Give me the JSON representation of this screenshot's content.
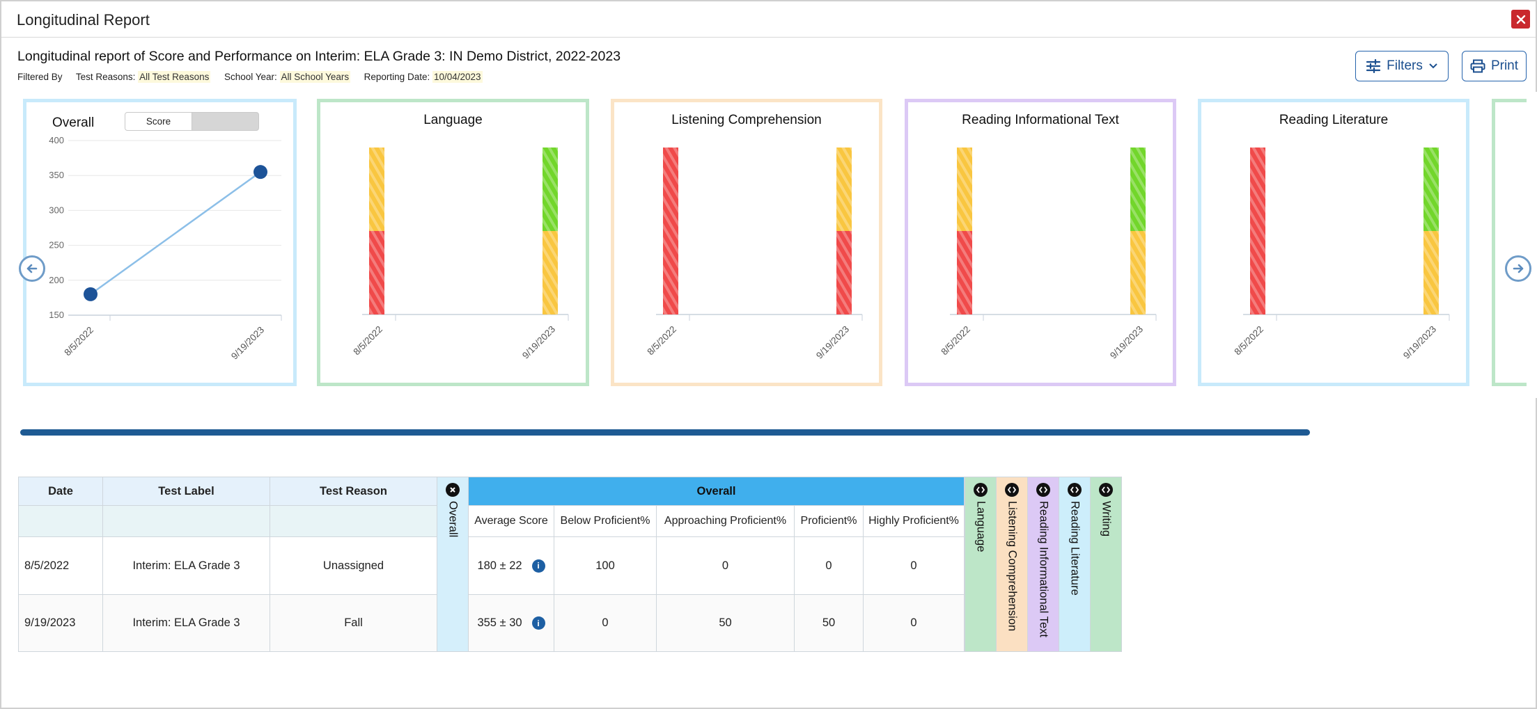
{
  "window": {
    "title": "Longitudinal Report"
  },
  "report": {
    "heading": "Longitudinal report of Score and Performance on Interim: ELA Grade 3: IN Demo District, 2022-2023",
    "filtered_by_label": "Filtered By",
    "filters": [
      {
        "label": "Test Reasons:",
        "value": "All Test Reasons"
      },
      {
        "label": "School Year:",
        "value": "All School Years"
      },
      {
        "label": "Reporting Date:",
        "value": "10/04/2023"
      }
    ],
    "filters_button": "Filters",
    "print_button": "Print"
  },
  "colors": {
    "red": "#f04a4a",
    "yellow": "#f9c640",
    "green": "#72d62b",
    "overall_header": "#40afed",
    "accent": "#1e5a93"
  },
  "overall_card": {
    "title": "Overall",
    "toggle": {
      "selected": "Score"
    },
    "chart_data": {
      "type": "line",
      "x": [
        "8/5/2022",
        "9/19/2023"
      ],
      "y": [
        180,
        355
      ],
      "ylim": [
        150,
        400
      ],
      "yticks": [
        400,
        350,
        300,
        250,
        200,
        150
      ],
      "grid": true
    }
  },
  "claim_cards": [
    {
      "key": "language",
      "title": "Language",
      "chart_data": {
        "type": "bar",
        "x": [
          "8/5/2022",
          "9/19/2023"
        ],
        "stacks": [
          [
            "red",
            "yellow"
          ],
          [
            "yellow",
            "green"
          ]
        ]
      }
    },
    {
      "key": "listening",
      "title": "Listening Comprehension",
      "chart_data": {
        "type": "bar",
        "x": [
          "8/5/2022",
          "9/19/2023"
        ],
        "stacks": [
          [
            "red"
          ],
          [
            "red",
            "yellow"
          ]
        ]
      }
    },
    {
      "key": "readinfo",
      "title": "Reading Informational Text",
      "chart_data": {
        "type": "bar",
        "x": [
          "8/5/2022",
          "9/19/2023"
        ],
        "stacks": [
          [
            "red",
            "yellow"
          ],
          [
            "yellow",
            "green"
          ]
        ]
      }
    },
    {
      "key": "readlit",
      "title": "Reading Literature",
      "chart_data": {
        "type": "bar",
        "x": [
          "8/5/2022",
          "9/19/2023"
        ],
        "stacks": [
          [
            "red"
          ],
          [
            "yellow",
            "green"
          ]
        ]
      }
    }
  ],
  "table": {
    "headers": {
      "date": "Date",
      "test_label": "Test Label",
      "test_reason": "Test Reason",
      "overall": "Overall"
    },
    "overall_vertical": "Overall",
    "subheaders": [
      "Average Score",
      "Below Proficient%",
      "Approaching Proficient%",
      "Proficient%",
      "Highly Proficient%"
    ],
    "rows": [
      {
        "date": "8/5/2022",
        "test_label": "Interim: ELA Grade 3",
        "test_reason": "Unassigned",
        "avg": "180 ± 22",
        "below": "100",
        "approaching": "0",
        "proficient": "0",
        "highly": "0"
      },
      {
        "date": "9/19/2023",
        "test_label": "Interim: ELA Grade 3",
        "test_reason": "Fall",
        "avg": "355 ± 30",
        "below": "0",
        "approaching": "50",
        "proficient": "50",
        "highly": "0"
      }
    ],
    "collapsed_columns": [
      "Language",
      "Listening Comprehension",
      "Reading Informational Text",
      "Reading Literature",
      "Writing"
    ]
  }
}
